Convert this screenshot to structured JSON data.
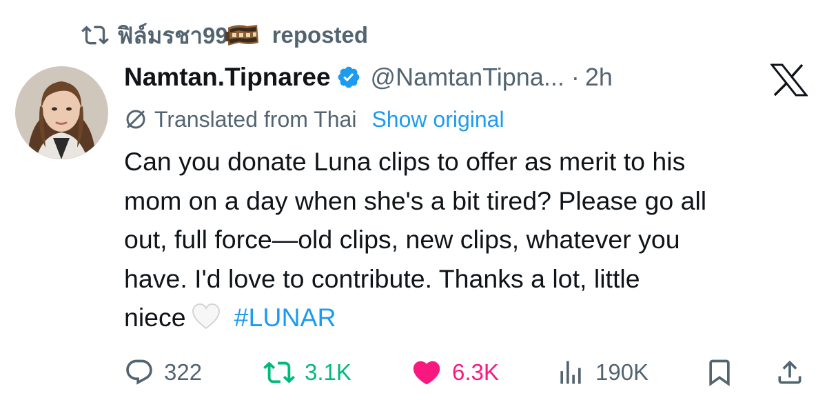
{
  "repost_banner": {
    "user": "ฟิล์มรชา99",
    "label": "reposted"
  },
  "author": {
    "display_name": "Namtan.Tipnaree",
    "handle": "@NamtanTipna...",
    "separator": "·",
    "time": "2h"
  },
  "translation": {
    "label": "Translated from Thai",
    "action": "Show original"
  },
  "text": {
    "line1": "Can you donate Luna clips to offer as merit to his",
    "line2": "mom on a day when she's a bit tired? Please go all",
    "line3": "out, full force—old clips, new clips, whatever you",
    "line4": "have. I'd love to contribute. Thanks a lot, little",
    "line5": "niece",
    "hashtag": "#LUNAR"
  },
  "metrics": {
    "replies": "322",
    "reposts": "3.1K",
    "likes": "6.3K",
    "views": "190K"
  },
  "colors": {
    "text": "#0f1419",
    "secondary": "#536471",
    "link": "#1d9bf0",
    "repost_active": "#00ba7c",
    "like_active": "#f91880"
  },
  "icons": {
    "banner": "repost-icon",
    "film": "film-strip-emoji",
    "verified": "verified-badge-icon",
    "platform": "x-logo-icon",
    "translate": "globe-translate-icon",
    "emoji": "white-heart-emoji",
    "reply": "reply-icon",
    "repost": "repost-icon",
    "like": "heart-icon",
    "views": "views-icon",
    "bookmark": "bookmark-icon",
    "share": "share-icon"
  }
}
